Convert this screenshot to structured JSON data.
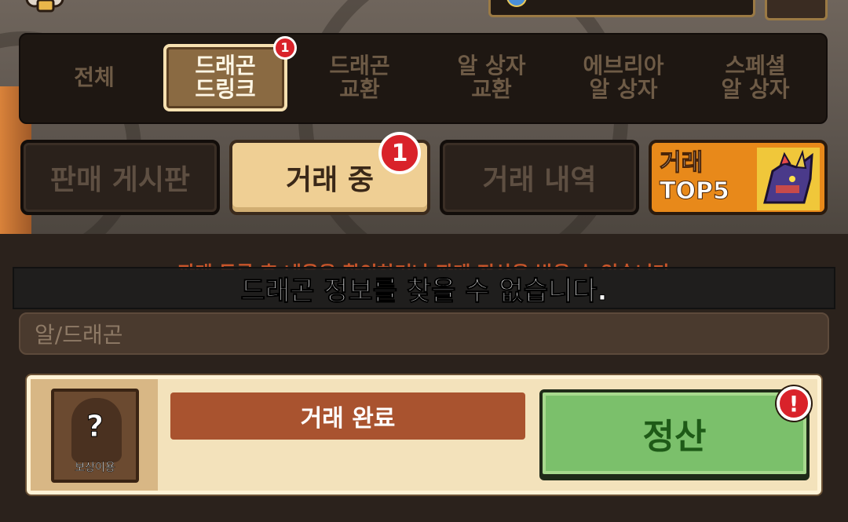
{
  "categories": [
    {
      "line1": "전체",
      "line2": "",
      "active": false
    },
    {
      "line1": "드래곤",
      "line2": "드링크",
      "active": true,
      "badge": "1"
    },
    {
      "line1": "드래곤",
      "line2": "교환",
      "active": false
    },
    {
      "line1": "알 상자",
      "line2": "교환",
      "active": false
    },
    {
      "line1": "에브리아",
      "line2": "알 상자",
      "active": false
    },
    {
      "line1": "스페셜",
      "line2": "알 상자",
      "active": false
    }
  ],
  "tabs": {
    "sell_board": "판매 게시판",
    "trading": "거래 중",
    "trading_badge": "1",
    "history": "거래 내역",
    "top5_line1": "거래",
    "top5_line2": "TOP5"
  },
  "notice": "판매 등록 후 내용을 확인하거나 판매 정산을 받을 수 있습니다",
  "toast": "드래곤 정보를 찾을 수 없습니다.",
  "filter": {
    "placeholder": "알/드래곤"
  },
  "trade_card": {
    "reward_mark": "?",
    "reward_label": "보상이용",
    "status": "거래 완료",
    "settle_label": "정산",
    "alert": "!"
  },
  "colors": {
    "active_tab": "#efcf94",
    "settle_button": "#7bc06b",
    "badge": "#d9222a",
    "top5": "#e8891a"
  }
}
